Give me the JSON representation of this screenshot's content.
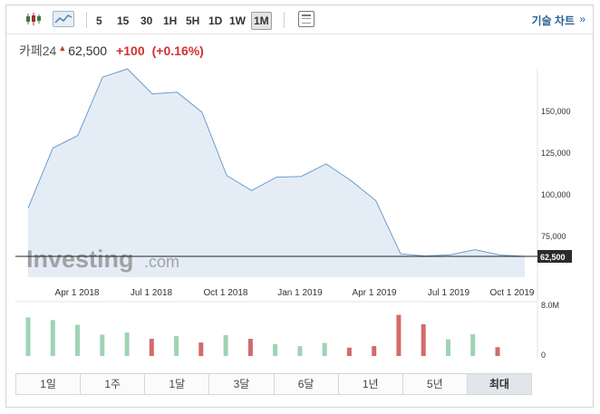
{
  "toolbar": {
    "timeframes": [
      "5",
      "15",
      "30",
      "1H",
      "5H",
      "1D",
      "1W",
      "1M"
    ],
    "active_timeframe": "1M",
    "tech_chart_label": "기술 차트",
    "tech_chart_arrow": "»"
  },
  "quote": {
    "name": "카페24",
    "price": "62,500",
    "change": "+100",
    "change_pct": "(+0.16%)"
  },
  "watermark": {
    "brand": "Investing",
    "suffix": ".com"
  },
  "price_label": "62,500",
  "range_buttons": [
    "1일",
    "1주",
    "1달",
    "3달",
    "6달",
    "1년",
    "5년",
    "최대"
  ],
  "active_range": "최대",
  "colors": {
    "line": "#6f9ccb",
    "area": "#e4edf6",
    "volume_up": "#9fd3b4",
    "volume_down": "#d46a6a",
    "change": "#d2312f"
  },
  "chart_data": {
    "type": "area",
    "price_axis": {
      "min": 50000,
      "max": 175000,
      "ticks": [
        150000,
        125000,
        100000,
        75000
      ],
      "tick_labels": [
        "150,000",
        "125,000",
        "100,000",
        "75,000"
      ]
    },
    "x_labels": [
      "Apr 1 2018",
      "Jul 1 2018",
      "Oct 1 2018",
      "Jan 1 2019",
      "Apr 1 2019",
      "Jul 1 2019",
      "Oct 1 2019"
    ],
    "series": [
      {
        "values": [
          91500,
          127500,
          135000,
          170000,
          175000,
          160000,
          161000,
          149000,
          111000,
          102000,
          110000,
          110500,
          118000,
          108000,
          96000,
          64000,
          62700,
          63500,
          66500,
          63300,
          62500
        ]
      }
    ],
    "current_price": 62500,
    "volume": {
      "axis_max_label": "8.0M",
      "axis_zero_label": "0",
      "max": 8000000,
      "values": [
        7400000,
        6900000,
        6000000,
        4100000,
        4500000,
        3300000,
        3800000,
        2600000,
        4000000,
        3300000,
        2300000,
        1900000,
        2500000,
        1600000,
        1900000,
        7900000,
        6100000,
        3200000,
        4200000,
        1700000
      ],
      "direction": [
        "up",
        "up",
        "up",
        "up",
        "up",
        "down",
        "up",
        "down",
        "up",
        "down",
        "up",
        "up",
        "up",
        "down",
        "down",
        "down",
        "down",
        "up",
        "up",
        "down"
      ]
    }
  }
}
